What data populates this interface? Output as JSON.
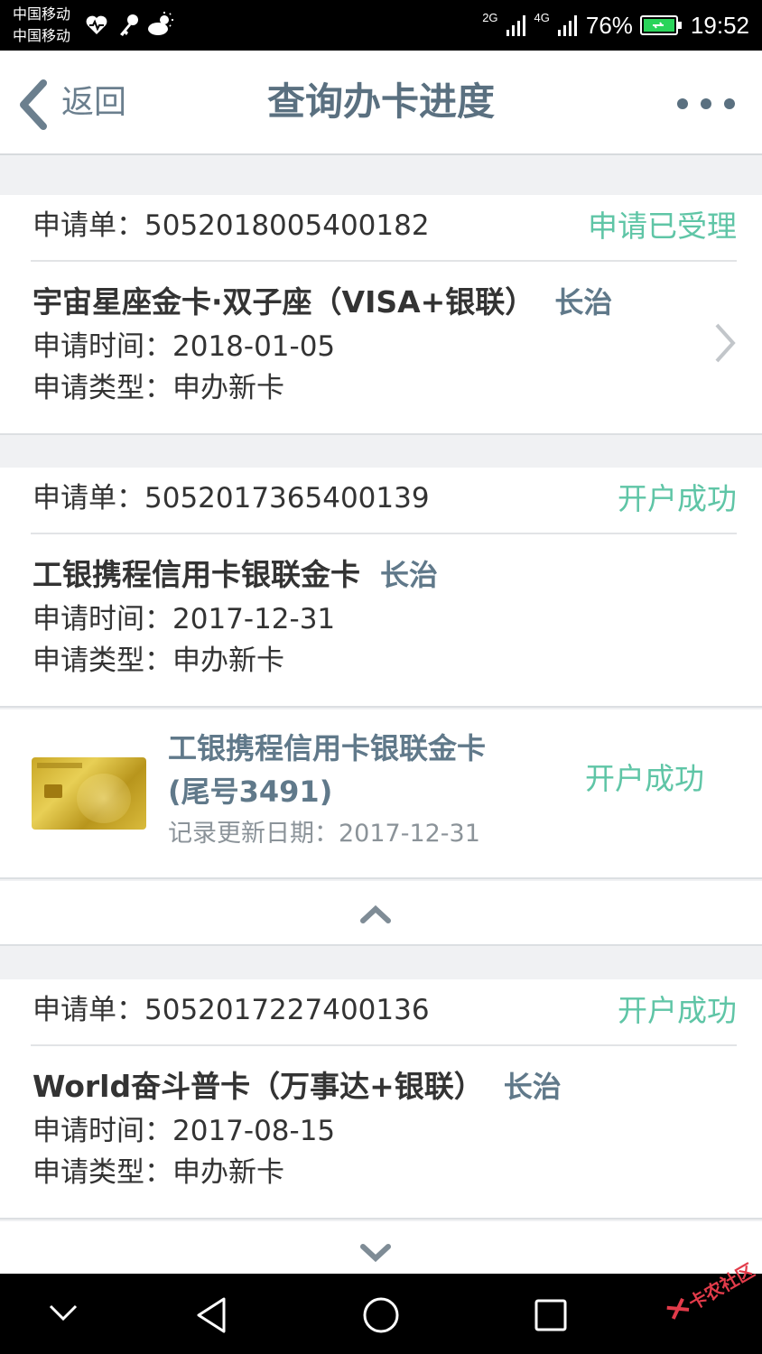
{
  "status_bar": {
    "carrier1": "中国移动",
    "carrier2": "中国移动",
    "net1": "2G",
    "net2": "4G",
    "battery": "76%",
    "time": "19:52"
  },
  "header": {
    "back_label": "返回",
    "title": "查询办卡进度"
  },
  "applications": [
    {
      "order_label": "申请单：5052018005400182",
      "status": "申请已受理",
      "card_name": "宇宙星座金卡·双子座（VISA+银联）",
      "city": "长治",
      "apply_time": "申请时间：2018-01-05",
      "apply_type": "申请类型：申办新卡"
    },
    {
      "order_label": "申请单：5052017365400139",
      "status": "开户成功",
      "card_name": "工银携程信用卡银联金卡",
      "city": "长治",
      "apply_time": "申请时间：2017-12-31",
      "apply_type": "申请类型：申办新卡",
      "sub_card": {
        "name_line1": "工银携程信用卡银联金卡",
        "name_line2": "(尾号3491)",
        "update_date": "记录更新日期：2017-12-31",
        "status": "开户成功"
      }
    },
    {
      "order_label": "申请单：5052017227400136",
      "status": "开户成功",
      "card_name": "World奋斗普卡（万事达+银联）",
      "city": "长治",
      "apply_time": "申请时间：2017-08-15",
      "apply_type": "申请类型：申办新卡"
    }
  ],
  "watermark": "卡农社区",
  "colors": {
    "accent_green": "#5fc5a6",
    "slate_blue": "#60798a"
  }
}
